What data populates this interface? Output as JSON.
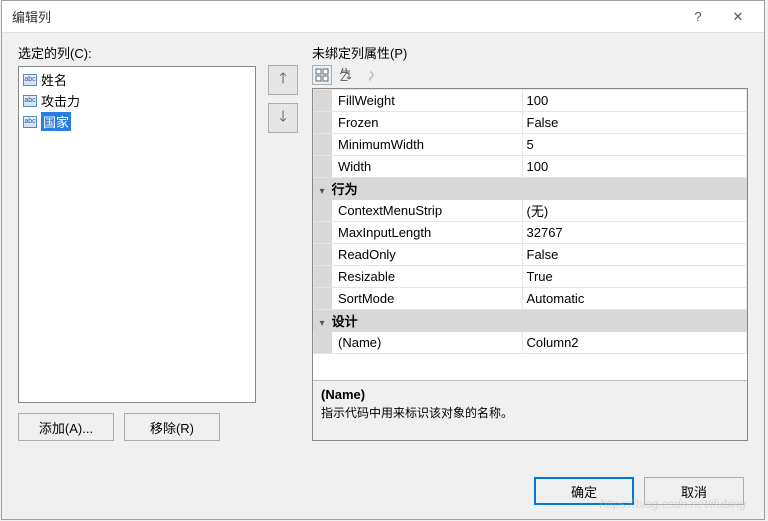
{
  "titlebar": {
    "title": "编辑列"
  },
  "left": {
    "label": "选定的列(C):",
    "items": [
      {
        "text": "姓名",
        "selected": false
      },
      {
        "text": "攻击力",
        "selected": false
      },
      {
        "text": "国家",
        "selected": true
      }
    ],
    "add_btn": "添加(A)...",
    "remove_btn": "移除(R)"
  },
  "right": {
    "label": "未绑定列属性(P)",
    "rows": [
      {
        "type": "prop",
        "name": "FillWeight",
        "value": "100"
      },
      {
        "type": "prop",
        "name": "Frozen",
        "value": "False"
      },
      {
        "type": "prop",
        "name": "MinimumWidth",
        "value": "5"
      },
      {
        "type": "prop",
        "name": "Width",
        "value": "100"
      },
      {
        "type": "cat",
        "name": "行为"
      },
      {
        "type": "prop",
        "name": "ContextMenuStrip",
        "value": "(无)"
      },
      {
        "type": "prop",
        "name": "MaxInputLength",
        "value": "32767"
      },
      {
        "type": "prop",
        "name": "ReadOnly",
        "value": "False"
      },
      {
        "type": "prop",
        "name": "Resizable",
        "value": "True"
      },
      {
        "type": "prop",
        "name": "SortMode",
        "value": "Automatic"
      },
      {
        "type": "cat",
        "name": "设计"
      },
      {
        "type": "prop",
        "name": "(Name)",
        "value": "Column2"
      }
    ],
    "desc_name": "(Name)",
    "desc_text": "指示代码中用来标识该对象的名称。"
  },
  "footer": {
    "ok": "确定",
    "cancel": "取消"
  },
  "watermark": "https://blog.csdn.net/ifubing"
}
